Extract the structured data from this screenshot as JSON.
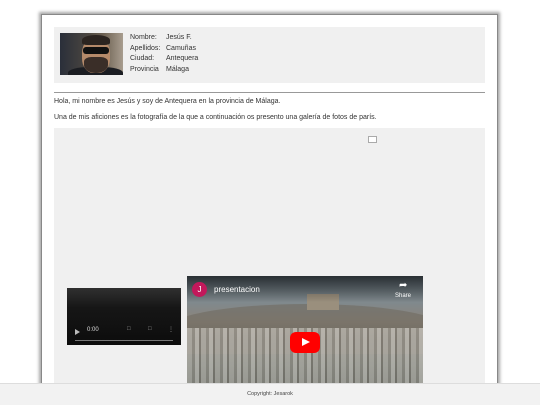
{
  "profile": {
    "rows": [
      {
        "label": "Nombre:",
        "value": "Jesús F."
      },
      {
        "label": "Apellidos:",
        "value": "Camuñas"
      },
      {
        "label": "Ciudad:",
        "value": "Antequera"
      },
      {
        "label": "Provincia",
        "value": "Málaga"
      }
    ]
  },
  "content": {
    "intro": "Hola, mi nombre es Jesús y soy de Antequera en la provincia de Málaga.",
    "hobby": "Una de mis aficiones es la fotografía de la que a continuación os presento una galería de fotos de parís."
  },
  "video_player": {
    "time": "0:00"
  },
  "youtube": {
    "channel_initial": "J",
    "title": "presentacion",
    "share_label": "Share"
  },
  "footer": {
    "copyright": "Copyright: Jesarok"
  },
  "colors": {
    "panel_bg": "#f0f0f0",
    "youtube_red": "#ff0000",
    "channel_avatar": "#c2185b"
  },
  "icons": {
    "play": "play-icon",
    "mute": "volume-icon",
    "fullscreen": "fullscreen-icon",
    "menu": "more-options-icon",
    "share": "share-icon"
  }
}
